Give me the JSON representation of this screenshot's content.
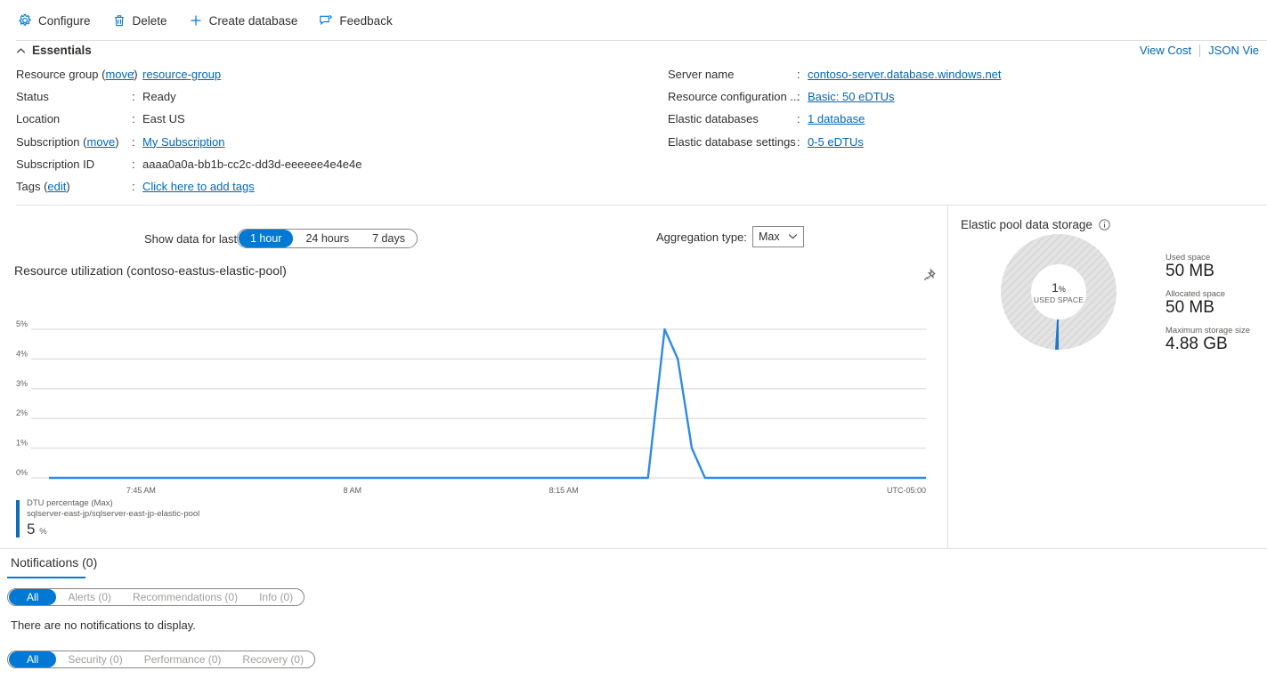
{
  "toolbar": {
    "items": [
      {
        "label": "Configure",
        "icon": "gear-icon"
      },
      {
        "label": "Delete",
        "icon": "trash-icon"
      },
      {
        "label": "Create database",
        "icon": "plus-icon"
      },
      {
        "label": "Feedback",
        "icon": "feedback-icon"
      }
    ]
  },
  "essentials": {
    "header": "Essentials",
    "top_links": [
      "View Cost",
      "JSON Vie"
    ],
    "left": [
      {
        "label": "Resource group",
        "sublink": "move",
        "colon": ":",
        "value": "resource-group",
        "is_link": true
      },
      {
        "label": "Status",
        "sublink": "",
        "colon": ":",
        "value": "Ready",
        "is_link": false
      },
      {
        "label": "Location",
        "sublink": "",
        "colon": ":",
        "value": "East US",
        "is_link": false
      },
      {
        "label": "Subscription",
        "sublink": "move",
        "colon": ":",
        "value": "My Subscription",
        "is_link": true
      },
      {
        "label": "Subscription ID",
        "sublink": "",
        "colon": ":",
        "value": "aaaa0a0a-bb1b-cc2c-dd3d-eeeeee4e4e4e",
        "is_link": false
      },
      {
        "label": "Tags",
        "sublink": "edit",
        "colon": ":",
        "value": "Click here to add tags",
        "is_link": true
      }
    ],
    "right": [
      {
        "label": "Server name",
        "colon": ":",
        "value": "contoso-server.database.windows.net",
        "is_link": true
      },
      {
        "label": "Resource configuration ...",
        "colon": ":",
        "value": "Basic: 50 eDTUs",
        "is_link": true
      },
      {
        "label": "Elastic databases",
        "colon": ":",
        "value": "1 database",
        "is_link": true
      },
      {
        "label": "Elastic database settings",
        "colon": ":",
        "value": "0-5 eDTUs",
        "is_link": true
      }
    ]
  },
  "chart_controls": {
    "show_data_label": "Show data for last:",
    "ranges": [
      {
        "label": "1 hour",
        "active": true
      },
      {
        "label": "24 hours",
        "active": false
      },
      {
        "label": "7 days",
        "active": false
      }
    ],
    "aggregation_label": "Aggregation type:",
    "aggregation_value": "Max"
  },
  "chart_panel": {
    "title": "Resource utilization (contoso-eastus-elastic-pool)",
    "pin_icon": "pin-icon"
  },
  "chart_data": {
    "type": "line",
    "title": "Resource utilization (contoso-eastus-elastic-pool)",
    "xlabel": "",
    "ylabel": "",
    "ylim": [
      0,
      5
    ],
    "yticks": [
      "0%",
      "1%",
      "2%",
      "3%",
      "4%",
      "5%"
    ],
    "ytick_values": [
      0,
      1,
      2,
      3,
      4,
      5
    ],
    "xticks": [
      "7:45 AM",
      "8 AM",
      "8:15 AM"
    ],
    "xtick_positions": [
      0.105,
      0.346,
      0.587
    ],
    "timezone_label": "UTC-05:00",
    "grid": true,
    "legend_position": "below",
    "series": [
      {
        "name": "DTU percentage (Max)",
        "resource": "sqlserver-east-jp/sqlserver-east-jp-elastic-pool",
        "current_value": "5",
        "unit": "%",
        "color": "#2e8ae6",
        "points": [
          {
            "x": 0.0,
            "y": 0
          },
          {
            "x": 0.67,
            "y": 0
          },
          {
            "x": 0.683,
            "y": 0
          },
          {
            "x": 0.702,
            "y": 5
          },
          {
            "x": 0.717,
            "y": 4
          },
          {
            "x": 0.733,
            "y": 1
          },
          {
            "x": 0.748,
            "y": 0
          },
          {
            "x": 1.0,
            "y": 0
          }
        ]
      }
    ]
  },
  "storage": {
    "title": "Elastic pool data storage",
    "info_icon": "info-icon",
    "donut_percent": "1",
    "donut_percent_symbol": "%",
    "donut_caption": "USED SPACE",
    "donut_fraction": 0.01,
    "donut_fill_color": "#1f77d0",
    "donut_track_color": "#e3e3e3",
    "stats": [
      {
        "label": "Used space",
        "value": "50 MB"
      },
      {
        "label": "Allocated space",
        "value": "50 MB"
      },
      {
        "label": "Maximum storage size",
        "value": "4.88 GB"
      }
    ]
  },
  "notifications": {
    "tab_label": "Notifications (0)",
    "filters_primary": [
      {
        "label": "All",
        "active": true
      },
      {
        "label": "Alerts (0)",
        "active": false
      },
      {
        "label": "Recommendations (0)",
        "active": false
      },
      {
        "label": "Info (0)",
        "active": false
      }
    ],
    "empty_message": "There are no notifications to display.",
    "filters_secondary": [
      {
        "label": "All",
        "active": true
      },
      {
        "label": "Security (0)",
        "active": false
      },
      {
        "label": "Performance (0)",
        "active": false
      },
      {
        "label": "Recovery (0)",
        "active": false
      }
    ]
  }
}
